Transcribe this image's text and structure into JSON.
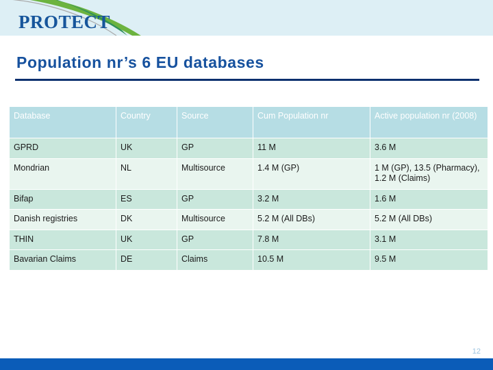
{
  "banner": {
    "logo_text": "PROTECT",
    "logo_color": "#16559b",
    "background_color": "#ddeff5",
    "swoosh_colors": [
      "#6cb33f",
      "#2f8f5b",
      "#9a9a9a"
    ]
  },
  "title": {
    "text": "Population nr’s 6 EU databases",
    "color": "#16519e",
    "rule_color": "#0b2f6e"
  },
  "table": {
    "header_bg": "#b6dde4",
    "header_text_color": "#ffffff",
    "row_dark_bg": "#c9e7dc",
    "row_light_bg": "#e9f5ef",
    "columns": [
      "Database",
      "Country",
      "Source",
      "Cum Population nr",
      "Active population nr (2008)"
    ],
    "rows": [
      {
        "database": "GPRD",
        "country": "UK",
        "source": "GP",
        "cum_population": "11 M",
        "active_population": "3.6 M"
      },
      {
        "database": "Mondrian",
        "country": "NL",
        "source": "Multisource",
        "cum_population": "1.4 M (GP)",
        "active_population": "1 M (GP), 13.5 (Pharmacy), 1.2 M (Claims)"
      },
      {
        "database": "Bifap",
        "country": "ES",
        "source": "GP",
        "cum_population": "3.2 M",
        "active_population": "1.6 M"
      },
      {
        "database": "Danish registries",
        "country": "DK",
        "source": "Multisource",
        "cum_population": "5.2 M (All DBs)",
        "active_population": "5.2 M (All DBs)"
      },
      {
        "database": "THIN",
        "country": "UK",
        "source": "GP",
        "cum_population": "7.8 M",
        "active_population": "3.1 M"
      },
      {
        "database": "Bavarian Claims",
        "country": "DE",
        "source": "Claims",
        "cum_population": "10.5 M",
        "active_population": "9.5 M"
      }
    ]
  },
  "footer": {
    "page_number": "12",
    "bar_color": "#0b5cb8",
    "page_number_color": "#9dc4e0"
  }
}
